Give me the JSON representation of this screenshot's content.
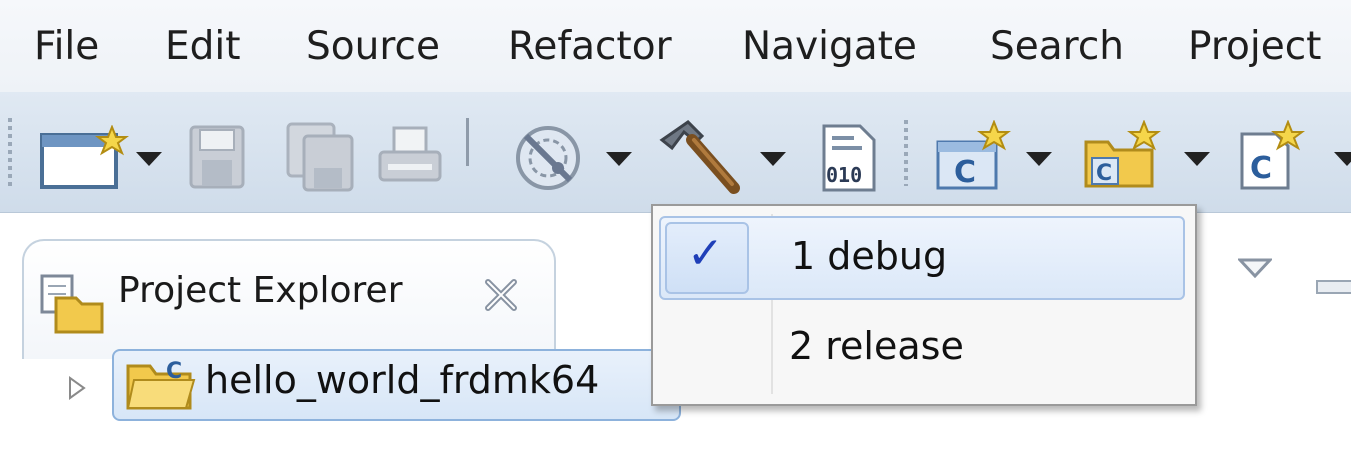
{
  "menubar": {
    "items": [
      {
        "label": "File"
      },
      {
        "label": "Edit"
      },
      {
        "label": "Source"
      },
      {
        "label": "Refactor"
      },
      {
        "label": "Navigate"
      },
      {
        "label": "Search"
      },
      {
        "label": "Project"
      }
    ]
  },
  "toolbar": {
    "icons": [
      "new-wizard-icon",
      "save-icon",
      "save-all-icon",
      "print-icon",
      "debug-config-icon",
      "build-hammer-icon",
      "binary-010-icon",
      "new-c-project-icon",
      "new-c-folder-icon",
      "new-c-class-icon"
    ],
    "binary_label": "010",
    "c_letter": "C"
  },
  "project_explorer": {
    "tab_label": "Project Explorer",
    "project_name": "hello_world_frdmk64"
  },
  "build_config_menu": {
    "items": [
      {
        "label": "1 debug",
        "checked": true
      },
      {
        "label": "2 release",
        "checked": false
      }
    ],
    "check_mark": "✓"
  },
  "colors": {
    "toolbar_bg": "#d4e0ec",
    "selection_border": "#a9c3e6",
    "check_mark": "#1f3fb8",
    "folder_yellow": "#f2c94c"
  }
}
